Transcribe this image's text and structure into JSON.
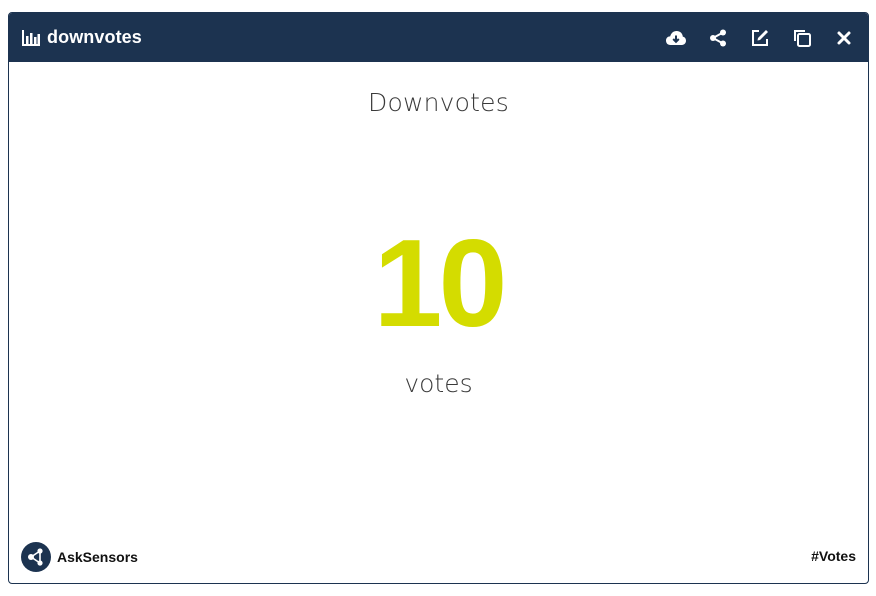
{
  "header": {
    "title": "downvotes",
    "title_icon": "bar-chart-icon",
    "actions": [
      {
        "name": "download-cloud-icon"
      },
      {
        "name": "share-icon"
      },
      {
        "name": "edit-icon"
      },
      {
        "name": "duplicate-icon"
      },
      {
        "name": "close-icon"
      }
    ]
  },
  "widget": {
    "title": "Downvotes",
    "value": "10",
    "unit": "votes",
    "value_color": "#d4dc00"
  },
  "footer": {
    "brand": "AskSensors",
    "tag": "#Votes"
  },
  "colors": {
    "header_bg": "#1c3350",
    "border": "#1c3350"
  }
}
